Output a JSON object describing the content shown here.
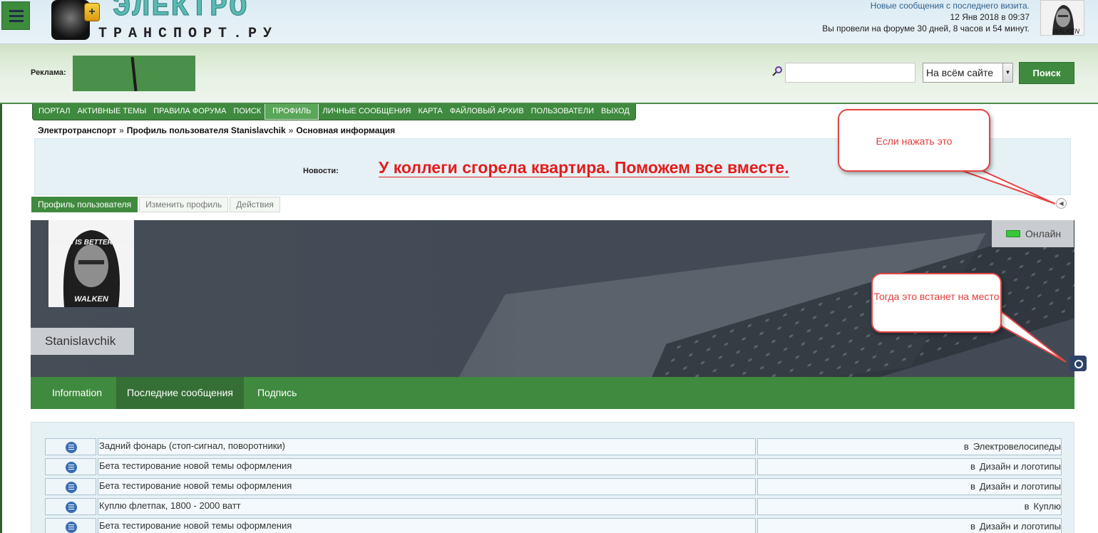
{
  "header": {
    "logo_top": "ЭЛЕКТРО",
    "logo_bottom": "ТРАНСПОРТ.РУ",
    "logo_battery": "+",
    "visit_line1": "Новые сообщения с последнего визита.",
    "visit_line2": "12 Янв 2018 в 09:37",
    "visit_line3": "Вы провели на форуме 30 дней, 8 часов и 54 минут.",
    "avatar_caption": "WALKEN"
  },
  "adbar": {
    "ad_label": "Реклама:",
    "search_placeholder": "",
    "scope_value": "На всём сайте",
    "search_button": "Поиск"
  },
  "nav": {
    "items": [
      "ПОРТАЛ",
      "АКТИВНЫЕ ТЕМЫ",
      "ПРАВИЛА ФОРУМА",
      "ПОИСК",
      "ПРОФИЛЬ",
      "ЛИЧНЫЕ СООБЩЕНИЯ",
      "КАРТА",
      "ФАЙЛОВЫЙ АРХИВ",
      "ПОЛЬЗОВАТЕЛИ",
      "ВЫХОД"
    ],
    "active": "ПРОФИЛЬ"
  },
  "breadcrumb": {
    "items": [
      "Электротранспорт",
      "Профиль пользователя Stanislavchik",
      "Основная информация"
    ],
    "separator": "»"
  },
  "news": {
    "label": "Новости:",
    "text": "У коллеги сгорела квартира. Поможем все вместе."
  },
  "subtabs": [
    "Профиль пользователя",
    "Изменить профиль",
    "Действия"
  ],
  "profile": {
    "username": "Stanislavchik",
    "status": "Онлайн",
    "avatar_text_top": "RIDING IS BETTER THAN",
    "avatar_text_bottom": "WALKEN"
  },
  "profile_tabs": [
    "Information",
    "Последние сообщения",
    "Подпись"
  ],
  "posts": {
    "in_label": "в",
    "rows": [
      {
        "title": "Задний фонарь (стоп-сигнал, поворотники)",
        "forum": "Электровелосипеды"
      },
      {
        "title": "Бета тестирование новой темы оформления",
        "forum": "Дизайн и логотипы"
      },
      {
        "title": "Бета тестирование новой темы оформления",
        "forum": "Дизайн и логотипы"
      },
      {
        "title": "Куплю флетпак, 1800 - 2000 ватт",
        "forum": "Куплю"
      },
      {
        "title": "Бета тестирование новой темы оформления",
        "forum": "Дизайн и логотипы"
      }
    ]
  },
  "callouts": {
    "first": "Если нажать это",
    "second": "Тогда это встанет на место"
  },
  "colors": {
    "brand_green": "#3f8a3f",
    "news_red": "#e31c1c",
    "callout_red": "#e34545",
    "cover_bg": "#424b55"
  },
  "icons": [
    "menu-icon",
    "search-icon",
    "collapse-toggle-icon",
    "battery-icon",
    "camera-icon",
    "post-icon"
  ]
}
